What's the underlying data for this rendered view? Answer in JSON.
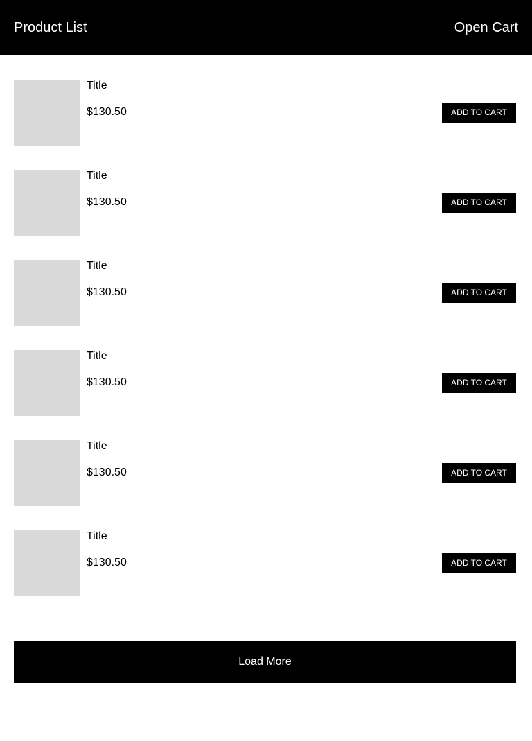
{
  "header": {
    "title": "Product List",
    "cart_label": "Open Cart"
  },
  "products": [
    {
      "title": "Title",
      "price": "$130.50",
      "button_label": "ADD TO CART"
    },
    {
      "title": "Title",
      "price": "$130.50",
      "button_label": "ADD TO CART"
    },
    {
      "title": "Title",
      "price": "$130.50",
      "button_label": "ADD TO CART"
    },
    {
      "title": "Title",
      "price": "$130.50",
      "button_label": "ADD TO CART"
    },
    {
      "title": "Title",
      "price": "$130.50",
      "button_label": "ADD TO CART"
    },
    {
      "title": "Title",
      "price": "$130.50",
      "button_label": "ADD TO CART"
    }
  ],
  "load_more_label": "Load More",
  "colors": {
    "header_bg": "#000000",
    "thumb_placeholder": "#d9d9d9",
    "button_bg": "#000000",
    "button_text": "#ffffff"
  }
}
